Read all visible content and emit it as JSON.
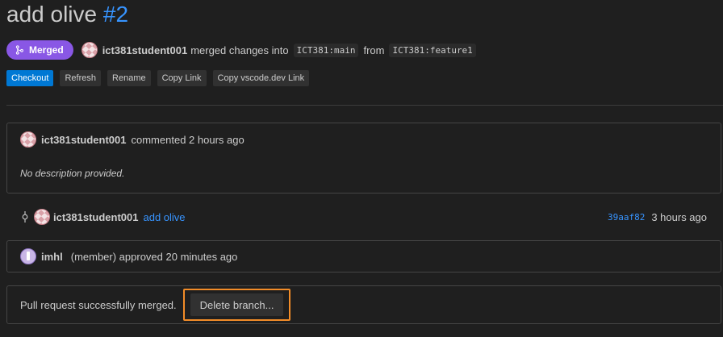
{
  "header": {
    "title_text": "add olive",
    "pr_number": "#2"
  },
  "status": {
    "badge_label": "Merged",
    "user": "ict381student001",
    "merged_text": "merged changes into",
    "target_branch": "ICT381:main",
    "from_text": "from",
    "source_branch": "ICT381:feature1",
    "badge_color": "#8957e5"
  },
  "actions": {
    "checkout": "Checkout",
    "refresh": "Refresh",
    "rename": "Rename",
    "copy_link": "Copy Link",
    "copy_vscode_link": "Copy vscode.dev Link"
  },
  "comment": {
    "user": "ict381student001",
    "meta": "commented 2 hours ago",
    "body": "No description provided."
  },
  "commit": {
    "user": "ict381student001",
    "message": "add olive",
    "sha": "39aaf82",
    "time": "3 hours ago"
  },
  "review": {
    "user": "imhl",
    "text": "(member) approved 20 minutes ago"
  },
  "merge": {
    "status_text": "Pull request successfully merged.",
    "delete_branch_label": "Delete branch...",
    "highlight_color": "#f28c28"
  }
}
